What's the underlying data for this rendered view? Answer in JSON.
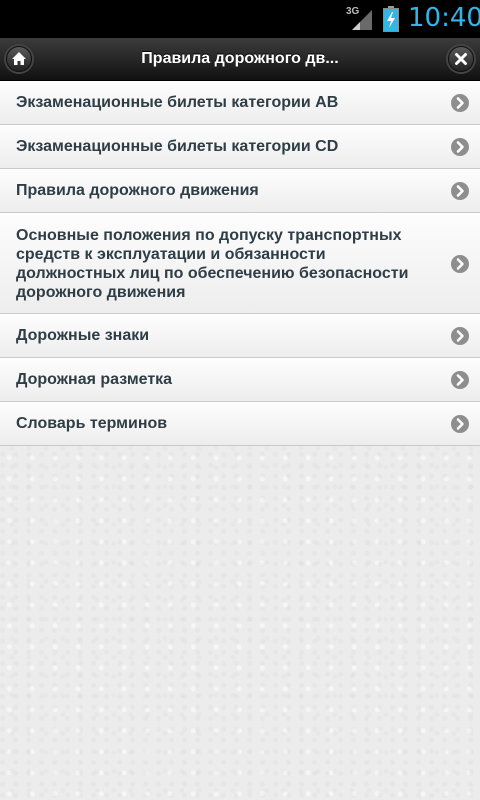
{
  "status_bar": {
    "network": "3G",
    "time": "10:40",
    "clock_color": "#33b5e5"
  },
  "header": {
    "title": "Правила дорожного дв...",
    "home_icon": "home-icon",
    "close_icon": "close-icon"
  },
  "menu": {
    "items": [
      {
        "label": "Экзаменационные билеты категории AB"
      },
      {
        "label": "Экзаменационные билеты категории CD"
      },
      {
        "label": "Правила дорожного движения"
      },
      {
        "label": "Основные положения по допуску транспортных средств к эксплуатации и обязанности должностных лиц по обеспечению безопасности дорожного движения"
      },
      {
        "label": "Дорожные знаки"
      },
      {
        "label": "Дорожная разметка"
      },
      {
        "label": "Словарь терминов"
      }
    ],
    "arrow_icon": "chevron-right-icon"
  }
}
